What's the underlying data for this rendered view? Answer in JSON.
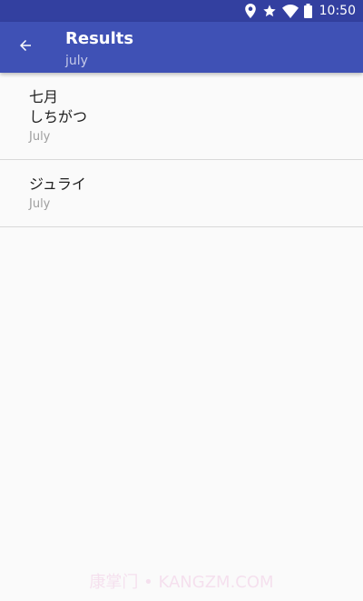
{
  "status_bar": {
    "time": "10:50",
    "icons": [
      "location-icon",
      "star-icon",
      "wifi-icon",
      "battery-icon"
    ]
  },
  "app_bar": {
    "back_icon": "arrow-back-icon",
    "title": "Results",
    "subtitle": "july"
  },
  "results": [
    {
      "lines": [
        "七月",
        "しちがつ"
      ],
      "meaning": "July"
    },
    {
      "lines": [
        "ジュライ"
      ],
      "meaning": "July"
    }
  ],
  "watermark": "康掌门 • KANGZM.COM",
  "colors": {
    "status_bar": "#3340a0",
    "app_bar": "#3f51b5",
    "background": "#fafafa",
    "divider": "#d9d9d9"
  }
}
